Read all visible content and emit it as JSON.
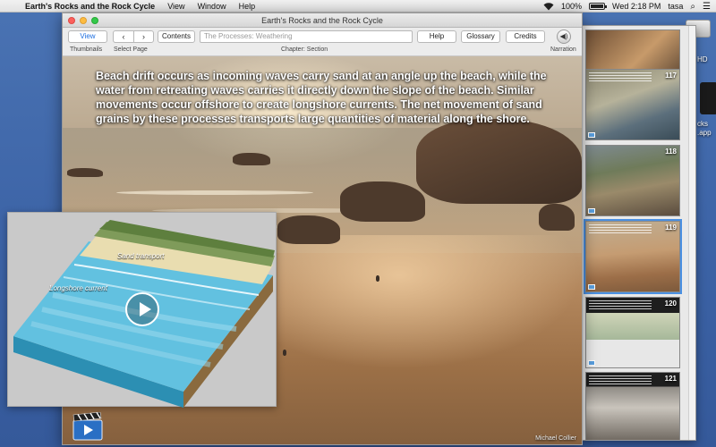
{
  "menubar": {
    "app_name": "Earth's Rocks and the Rock Cycle",
    "menus": [
      "View",
      "Window",
      "Help"
    ],
    "battery": "100%",
    "clock": "Wed 2:18 PM",
    "user": "tasa"
  },
  "window": {
    "title": "Earth's Rocks and the Rock Cycle"
  },
  "toolbar": {
    "view_label": "View",
    "thumbnails_label": "Thumbnails",
    "select_page_label": "Select Page",
    "prev_glyph": "‹",
    "next_glyph": "›",
    "contents_label": "Contents",
    "chapter_field_value": "The Processes: Weathering",
    "chapter_section_label": "Chapter: Section",
    "help_label": "Help",
    "glossary_label": "Glossary",
    "credits_label": "Credits",
    "narration_label": "Narration"
  },
  "page": {
    "caption": "Beach drift occurs as incoming waves carry sand at an angle up the beach, while the water from retreating waves carries it directly down the slope of the beach. Similar movements occur offshore to create longshore currents. The net movement of sand grains by these processes transports large quantities of material along the shore.",
    "photo_credit": "Michael Collier"
  },
  "video": {
    "label_sand_transport": "Sand transport",
    "label_longshore_current": "Longshore current"
  },
  "thumbnails": [
    {
      "num": ""
    },
    {
      "num": "117"
    },
    {
      "num": "118"
    },
    {
      "num": "119"
    },
    {
      "num": "120"
    },
    {
      "num": "121"
    }
  ],
  "desktop": {
    "hd_label": "HD",
    "app_label_1": "cks",
    "app_label_2": ".app"
  },
  "colors": {
    "accent": "#1e6fe0",
    "selection": "#4a90e2",
    "desktop": "#4a73b3"
  }
}
